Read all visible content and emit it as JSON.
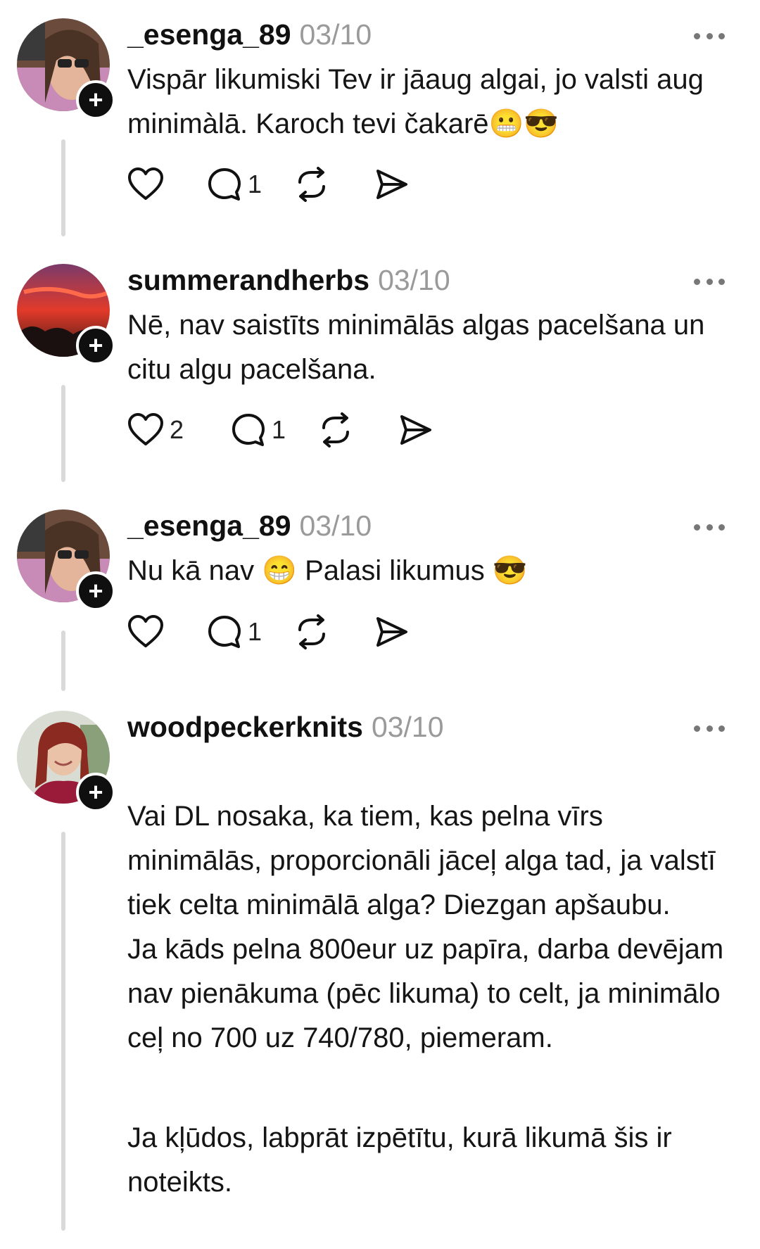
{
  "posts": [
    {
      "username": "_esenga_89",
      "date": "03/10",
      "lines": [
        "Vispār likumiski Tev ir jāaug algai, jo valsti aug minimàlā. Karoch tevi čakarē😬😎"
      ],
      "likes": "",
      "replies": "1"
    },
    {
      "username": "summerandherbs",
      "date": "03/10",
      "lines": [
        "Nē, nav saistīts minimālās algas pacelšana un citu algu pacelšana."
      ],
      "likes": "2",
      "replies": "1"
    },
    {
      "username": "_esenga_89",
      "date": "03/10",
      "lines": [
        "Nu kā nav 😁 Palasi likumus 😎"
      ],
      "likes": "",
      "replies": "1"
    },
    {
      "username": "woodpeckerknits",
      "date": "03/10",
      "paragraphs": [
        "Vai DL nosaka, ka tiem, kas pelna vīrs minimālās, proporcionāli jāceļ alga tad, ja valstī tiek celta minimālā alga? Diezgan apšaubu.\nJa kāds pelna 800eur uz papīra, darba devējam nav pienākuma (pēc likuma) to celt, ja minimālo ceļ no 700 uz 740/780, piemeram.",
        "Ja kļūdos, labprāt izpētītu, kurā likumā šis ir noteikts."
      ]
    }
  ],
  "icons": {
    "like": "heart-icon",
    "reply": "comment-icon",
    "repost": "repost-icon",
    "share": "send-icon",
    "more": "more-icon",
    "follow": "plus-icon"
  },
  "colors": {
    "text": "#151515",
    "muted": "#9a9a9a",
    "thread_line": "#d9d9d9"
  }
}
